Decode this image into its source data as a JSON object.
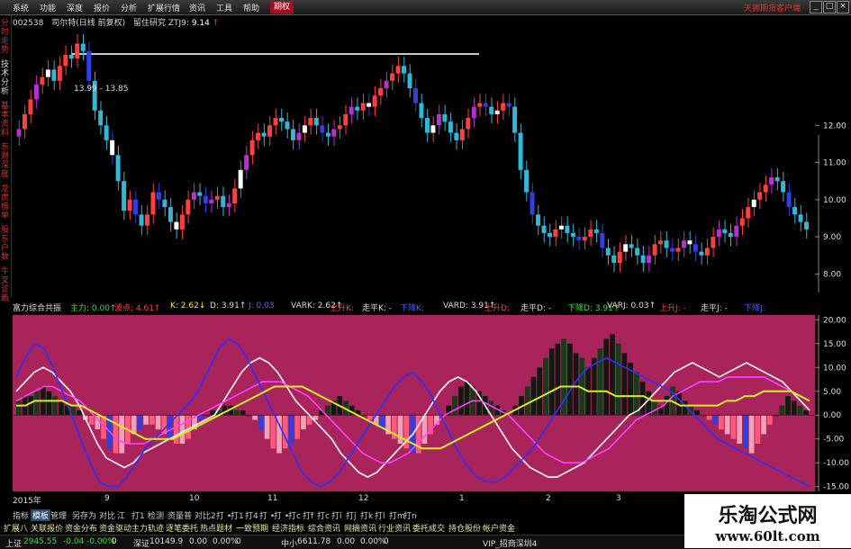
{
  "menubar": {
    "items": [
      "系统",
      "功能",
      "深度",
      "报价",
      "分析",
      "扩展行情",
      "资讯",
      "工具",
      "帮助",
      "期权"
    ],
    "active_index": 9,
    "brand": "天狮期货客户端",
    "win_buttons": [
      "_",
      "□",
      "×"
    ]
  },
  "left_tabs": [
    "分时走势",
    "技术分析",
    "基本资料",
    "东财深度",
    "龙虎榜单",
    "股东户数",
    "牛叉诊断"
  ],
  "left_tabs_active": 1,
  "main_header": {
    "code": "002538",
    "name": "司尔特(日线 前复权)",
    "indicator": "留住研究 ZTJ9:",
    "value": "9.14",
    "arrow": "↑"
  },
  "price_label": "13.99 - 13.85",
  "colors": {
    "panel_bg": "#a8245a",
    "up": "#ff4040",
    "down": "#30b8d8",
    "purple": "#b830d0",
    "blue": "#3040e0"
  },
  "sub_header": [
    {
      "text": "富力综合共振",
      "color": "#dddddd"
    },
    {
      "text": "主力: 0.00↑",
      "color": "#30e030"
    },
    {
      "text": "波点: 4.61↑",
      "color": "#ff4040"
    },
    {
      "text": "K: 2.62↓",
      "color": "#eeee40"
    },
    {
      "text": "D: 3.91↑",
      "color": "#dddddd"
    },
    {
      "text": "J: 0.03",
      "color": "#6060ff"
    },
    {
      "text": "VARK: 2.62↑",
      "color": "#dddddd"
    },
    {
      "text": "上升K:",
      "color": "#ff4040"
    },
    {
      "text": "走平K: -",
      "color": "#dddddd"
    },
    {
      "text": "下降K:",
      "color": "#4060ff"
    },
    {
      "text": "VARD: 3.91↑",
      "color": "#dddddd"
    },
    {
      "text": "上升D:",
      "color": "#ff4040"
    },
    {
      "text": "走平D: -",
      "color": "#dddddd"
    },
    {
      "text": "下降D: 3.91↑",
      "color": "#30e030"
    },
    {
      "text": "VARJ: 0.03↑",
      "color": "#dddddd"
    },
    {
      "text": "上升J: -",
      "color": "#ff4040"
    },
    {
      "text": "走平J: -",
      "color": "#dddddd"
    },
    {
      "text": "下降J:",
      "color": "#4060ff"
    }
  ],
  "date_axis": [
    "2015年",
    "9",
    "10",
    "11",
    "12",
    "1",
    "2",
    "3"
  ],
  "bottom_tabs": [
    "指标",
    "模板",
    "管理",
    "另存为",
    "对比",
    "江",
    "打1",
    "检测",
    "资量普",
    "对比2",
    "打 •",
    "打1",
    "打4",
    "打 •",
    "打 •",
    "打c",
    "打f",
    "打c",
    "打i",
    "打j",
    "打k",
    "打l",
    "打m",
    "打n"
  ],
  "bottom_tabs_selected": 1,
  "func_bar": [
    "扩展八",
    "关联报价",
    "资金分布",
    "资金驱动",
    "主力轨迹",
    "逐笔委托",
    "热点题材",
    "一致预期",
    "经济指标",
    "综合资讯",
    "网摘资讯",
    "行业资讯",
    "委托成交",
    "持仓股份",
    "帐户资金"
  ],
  "status_bar": [
    {
      "text": "上证",
      "color": "#dddddd"
    },
    {
      "text": "2945.55",
      "color": "#30e030"
    },
    {
      "text": "-0.04",
      "color": "#30e030"
    },
    {
      "text": "-0.00%",
      "color": "#30e030"
    },
    {
      "text": "0",
      "color": "#dddddd"
    },
    {
      "text": "深证",
      "color": "#dddddd"
    },
    {
      "text": "10149.9",
      "color": "#dddddd"
    },
    {
      "text": "0.00",
      "color": "#dddddd"
    },
    {
      "text": "0.00%",
      "color": "#dddddd"
    },
    {
      "text": "0",
      "color": "#dddddd"
    },
    {
      "text": "中小",
      "color": "#dddddd"
    },
    {
      "text": "6611.78",
      "color": "#dddddd"
    },
    {
      "text": "0.00",
      "color": "#dddddd"
    },
    {
      "text": "0.00%",
      "color": "#dddddd"
    },
    {
      "text": "0",
      "color": "#dddddd"
    },
    {
      "text": "VIP_招商深圳4",
      "color": "#dddddd"
    }
  ],
  "watermark": {
    "line1": "乐淘公式网",
    "line2": "www.60lt.com"
  },
  "chart_data": [
    {
      "type": "candlestick",
      "title": "",
      "y_axis_ticks": [
        12.0,
        11.0,
        10.0,
        9.0,
        8.0
      ],
      "ylim": [
        7.5,
        14.6
      ],
      "x_axis_ticks": [
        "2015年",
        "9",
        "10",
        "11",
        "12",
        "1",
        "2",
        "3"
      ],
      "reference_line": 13.92,
      "price_closes": [
        11.9,
        12.3,
        12.7,
        13.1,
        13.3,
        13.5,
        13.2,
        13.6,
        13.9,
        13.8,
        14.2,
        14.0,
        13.2,
        12.4,
        12.0,
        11.6,
        11.2,
        10.5,
        9.7,
        10.0,
        9.6,
        9.3,
        9.6,
        10.2,
        10.0,
        9.8,
        9.4,
        9.2,
        9.6,
        10.0,
        10.2,
        10.1,
        9.9,
        10.0,
        10.1,
        9.8,
        9.9,
        10.3,
        10.8,
        11.2,
        11.6,
        11.8,
        11.7,
        12.0,
        12.2,
        12.1,
        11.9,
        11.6,
        11.8,
        12.0,
        12.2,
        12.0,
        11.8,
        11.7,
        11.9,
        12.0,
        12.3,
        12.5,
        12.4,
        12.6,
        12.5,
        12.8,
        13.0,
        13.2,
        13.4,
        13.6,
        13.4,
        13.0,
        12.6,
        12.2,
        11.8,
        12.0,
        12.3,
        12.1,
        11.8,
        11.6,
        11.9,
        12.2,
        12.5,
        12.6,
        12.5,
        12.3,
        12.4,
        12.6,
        12.5,
        11.8,
        10.8,
        10.2,
        9.6,
        9.3,
        9.1,
        9.0,
        9.2,
        9.3,
        9.1,
        9.0,
        8.9,
        9.0,
        9.2,
        9.1,
        8.7,
        8.5,
        8.3,
        8.6,
        8.8,
        8.7,
        8.5,
        8.3,
        8.5,
        8.8,
        8.9,
        8.7,
        8.6,
        8.7,
        8.9,
        8.8,
        8.6,
        8.5,
        8.7,
        9.0,
        9.2,
        9.1,
        9.0,
        9.3,
        9.5,
        9.8,
        10.0,
        10.2,
        10.4,
        10.6,
        10.5,
        10.2,
        9.8,
        9.6,
        9.4,
        9.2
      ],
      "volume_style_bars_colors": [
        "up",
        "down",
        "purple",
        "blue"
      ]
    },
    {
      "type": "bar",
      "title": "富力综合共振",
      "y_axis_ticks": [
        20.0,
        15.0,
        10.0,
        5.0,
        0.0,
        -5.0,
        -10.0,
        -15.0
      ],
      "ylim": [
        -16,
        21
      ],
      "histogram": [
        3,
        4,
        4,
        5,
        6,
        5,
        4,
        3,
        2,
        2,
        1,
        -1,
        -2,
        -3,
        -5,
        -7,
        -8,
        -8,
        -6,
        -4,
        -3,
        -2,
        -2,
        -3,
        -4,
        -5,
        -6,
        -6,
        -5,
        -3,
        -1,
        0,
        1,
        1,
        2,
        2,
        1,
        1,
        0,
        -1,
        -3,
        -5,
        -7,
        -8,
        -7,
        -6,
        -5,
        -3,
        -2,
        -1,
        1,
        2,
        3,
        4,
        3,
        2,
        1,
        0,
        -1,
        -2,
        -3,
        -4,
        -5,
        -6,
        -7,
        -8,
        -8,
        -6,
        -4,
        -2,
        0,
        2,
        4,
        6,
        7,
        6,
        5,
        4,
        3,
        2,
        1,
        0,
        2,
        4,
        6,
        8,
        10,
        12,
        14,
        15,
        16,
        15,
        13,
        12,
        10,
        12,
        14,
        16,
        17,
        15,
        13,
        11,
        9,
        7,
        5,
        3,
        2,
        4,
        6,
        5,
        3,
        2,
        1,
        0,
        -1,
        -2,
        -3,
        -4,
        -5,
        -6,
        -7,
        -8,
        -6,
        -4,
        -2,
        0,
        2,
        4,
        3,
        2,
        1
      ],
      "series": [
        {
          "name": "K",
          "values": [
            5,
            7,
            9,
            10,
            9,
            7,
            5,
            2,
            -2,
            -6,
            -9,
            -10,
            -11,
            -10,
            -8,
            -7,
            -6,
            -5,
            -4,
            -3,
            -2,
            -1,
            0,
            3,
            6,
            9,
            11,
            12,
            11,
            9,
            6,
            3,
            1,
            -1,
            -3,
            -5,
            -8,
            -10,
            -12,
            -13,
            -12,
            -10,
            -8,
            -6,
            -4,
            -1,
            2,
            5,
            7,
            8,
            7,
            5,
            2,
            -1,
            -4,
            -7,
            -9,
            -11,
            -12,
            -13,
            -13,
            -12,
            -11,
            -10,
            -8,
            -6,
            -4,
            -2,
            0,
            1,
            3,
            5,
            7,
            9,
            10,
            11,
            10,
            9,
            8,
            9,
            10,
            11,
            10,
            9,
            8,
            7,
            5,
            3,
            1
          ],
          "color": "#ffffff"
        },
        {
          "name": "D",
          "values": [
            3,
            4,
            5,
            6,
            6,
            5,
            4,
            3,
            1,
            -1,
            -3,
            -5,
            -6,
            -6,
            -6,
            -5,
            -4,
            -3,
            -2,
            -1,
            0,
            1,
            2,
            3,
            4,
            5,
            6,
            7,
            7,
            7,
            6,
            5,
            4,
            2,
            0,
            -2,
            -4,
            -6,
            -8,
            -9,
            -10,
            -10,
            -9,
            -8,
            -6,
            -4,
            -2,
            0,
            1,
            2,
            3,
            3,
            2,
            1,
            0,
            -2,
            -4,
            -6,
            -8,
            -9,
            -10,
            -10,
            -10,
            -9,
            -8,
            -7,
            -5,
            -3,
            -1,
            0,
            1,
            2,
            4,
            5,
            6,
            7,
            7,
            7,
            8,
            8,
            8,
            8,
            8,
            7,
            6,
            5,
            4,
            3
          ],
          "color": "#ff40ff"
        },
        {
          "name": "J",
          "values": [
            8,
            12,
            15,
            14,
            10,
            5,
            0,
            -5,
            -10,
            -14,
            -15,
            -15,
            -13,
            -10,
            -7,
            -5,
            -3,
            -1,
            1,
            3,
            6,
            10,
            14,
            16,
            15,
            12,
            8,
            4,
            0,
            -4,
            -8,
            -12,
            -14,
            -15,
            -14,
            -12,
            -9,
            -6,
            -3,
            0,
            3,
            6,
            8,
            9,
            7,
            4,
            0,
            -4,
            -8,
            -11,
            -13,
            -14,
            -14,
            -13,
            -11,
            -9,
            -7,
            -4,
            -1,
            2,
            5,
            8,
            10,
            11,
            12,
            11,
            10,
            9,
            8,
            7,
            6,
            5,
            3,
            1,
            -1,
            -3,
            -5,
            -6,
            -7,
            -8,
            -9,
            -10,
            -11,
            -12,
            -13,
            -14,
            -15
          ],
          "color": "#3030ff"
        },
        {
          "name": "MA",
          "values": [
            2,
            2,
            3,
            3,
            3,
            3,
            2,
            2,
            1,
            0,
            -1,
            -2,
            -3,
            -4,
            -5,
            -5,
            -5,
            -5,
            -4,
            -3,
            -2,
            -1,
            0,
            1,
            2,
            3,
            4,
            5,
            6,
            6,
            6,
            6,
            5,
            4,
            3,
            2,
            1,
            0,
            -1,
            -2,
            -3,
            -4,
            -5,
            -6,
            -7,
            -7,
            -7,
            -6,
            -5,
            -4,
            -3,
            -2,
            -1,
            0,
            1,
            2,
            3,
            4,
            5,
            6,
            6,
            6,
            5,
            5,
            5,
            4,
            4,
            4,
            4,
            3,
            3,
            3,
            2,
            2,
            2,
            2,
            2,
            3,
            3,
            4,
            4,
            5,
            5,
            5,
            5,
            4,
            3
          ],
          "color": "#d0f020"
        }
      ]
    }
  ]
}
